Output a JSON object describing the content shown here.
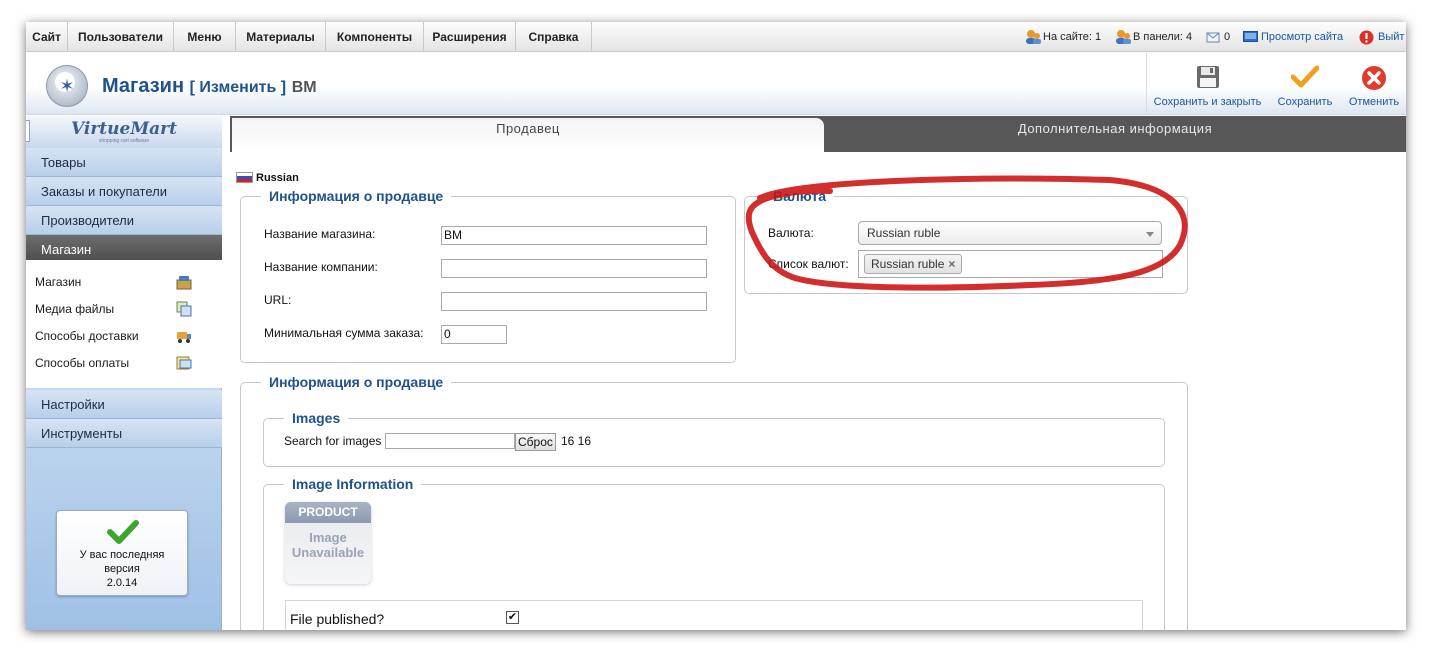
{
  "top_menu": {
    "items": [
      "Сайт",
      "Пользователи",
      "Меню",
      "Материалы",
      "Компоненты",
      "Расширения",
      "Справка"
    ],
    "status": {
      "on_site": "На сайте: 1",
      "in_panel": "В панели: 4",
      "messages": "0",
      "view_site": "Просмотр сайта",
      "logout": "Выйт"
    }
  },
  "header": {
    "title_main": "Магазин",
    "title_action": "[ Изменить ]",
    "title_item": "BM"
  },
  "toolbar": {
    "save_close": "Сохранить и закрыть",
    "save": "Сохранить",
    "cancel": "Отменить"
  },
  "sidebar": {
    "logo": "VirtueMart",
    "logo_sub": "shopping cart software",
    "items": [
      "Товары",
      "Заказы и покупатели",
      "Производители",
      "Магазин"
    ],
    "submenu": [
      "Магазин",
      "Медиа файлы",
      "Способы доставки",
      "Способы оплаты"
    ],
    "bottom_items": [
      "Настройки",
      "Инструменты"
    ],
    "version_line1": "У вас последняя",
    "version_line2": "версия",
    "version_number": "2.0.14"
  },
  "tabs": [
    "Продавец",
    "Дополнительная информация"
  ],
  "language": "Russian",
  "vendor_info": {
    "legend": "Информация о продавце",
    "store_name_label": "Название магазина:",
    "store_name_value": "BM",
    "company_name_label": "Название компании:",
    "company_name_value": "",
    "url_label": "URL:",
    "url_value": "",
    "min_order_label": "Минимальная сумма заказа:",
    "min_order_value": "0"
  },
  "currency": {
    "legend": "Валюта",
    "currency_label": "Валюта:",
    "currency_value": "Russian ruble",
    "list_label": "Список валют:",
    "list_chip": "Russian ruble",
    "chip_remove": "×"
  },
  "vendor_media": {
    "legend": "Информация о продавце",
    "images_legend": "Images",
    "search_label": "Search for images",
    "search_value": "",
    "reset_button": "Сброс",
    "counts": "16 16",
    "image_info_legend": "Image Information",
    "placeholder_band": "PRODUCT",
    "placeholder_line1": "Image",
    "placeholder_line2": "Unavailable",
    "published_label": "File published?",
    "published_checked": "✔"
  },
  "colors": {
    "title_blue": "#20528d",
    "link_blue": "#1a57a5",
    "annotation_red": "#cc1111",
    "sidebar_active": "#555555"
  }
}
